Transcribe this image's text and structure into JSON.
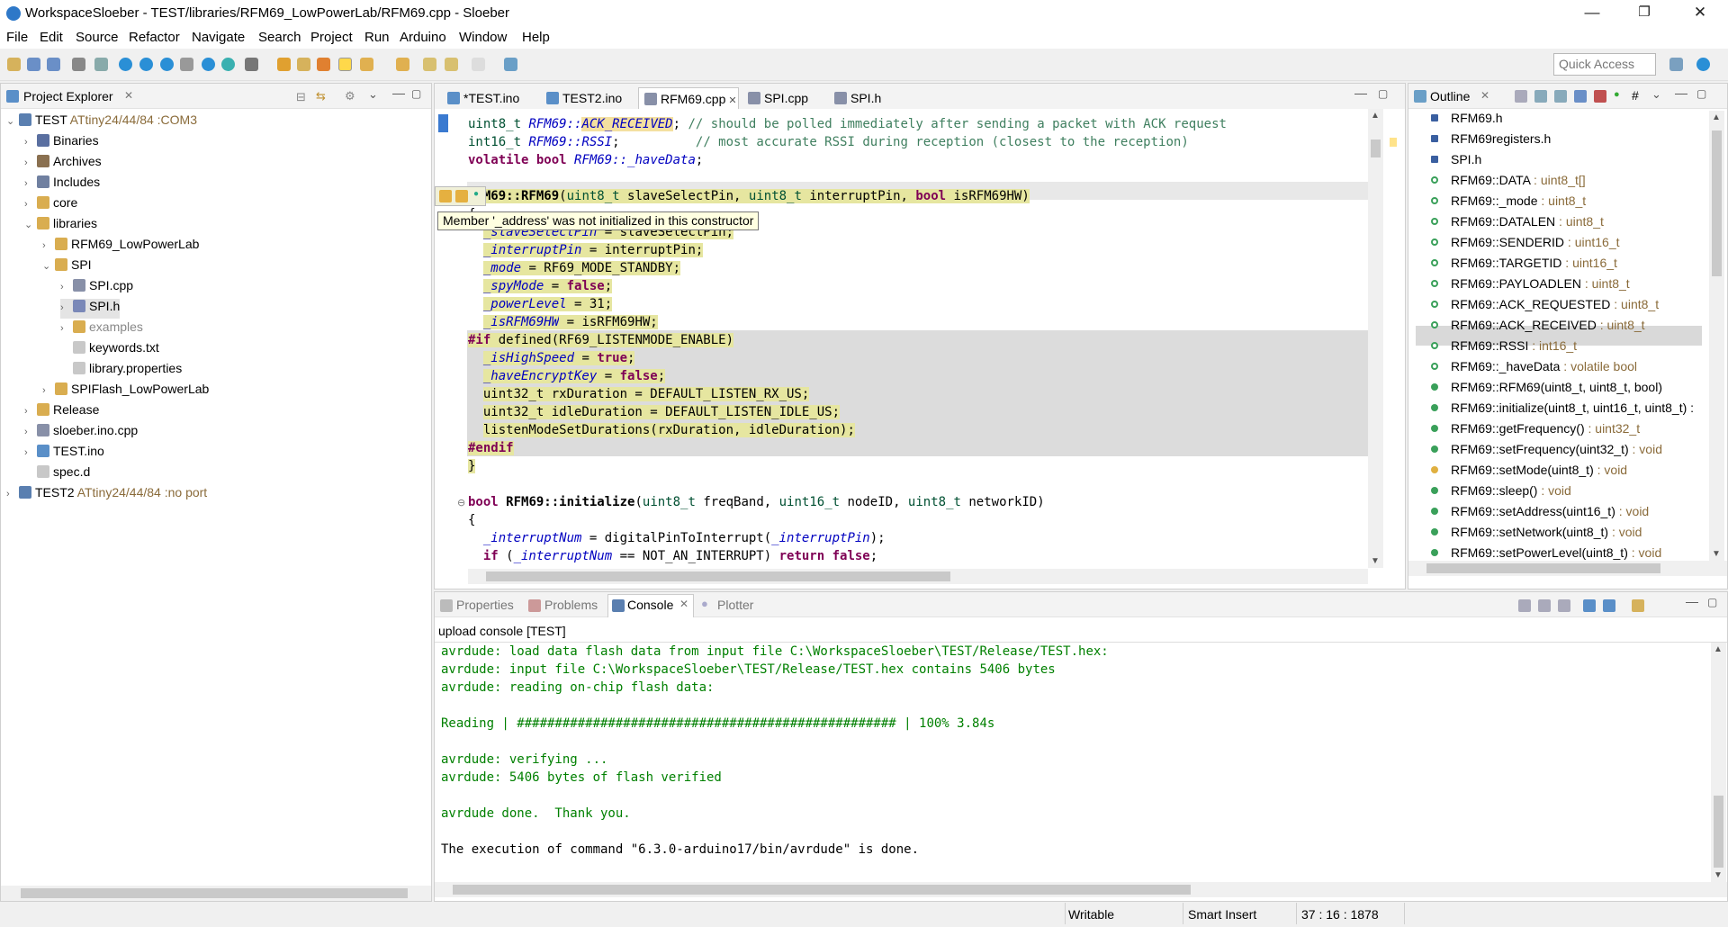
{
  "window": {
    "title": "WorkspaceSloeber - TEST/libraries/RFM69_LowPowerLab/RFM69.cpp - Sloeber",
    "minimize": "—",
    "restore": "❐",
    "close": "✕"
  },
  "menu": [
    "File",
    "Edit",
    "Source",
    "Refactor",
    "Navigate",
    "Search",
    "Project",
    "Run",
    "Arduino",
    "Window",
    "Help"
  ],
  "quick_access_placeholder": "Quick Access",
  "project_explorer": {
    "title": "Project Explorer",
    "close": "✕",
    "tree": [
      {
        "label": "TEST",
        "suffix": "ATtiny24/44/84 :COM3",
        "level": 0,
        "arrow": "⌄",
        "icon": "project-icon"
      },
      {
        "label": "Binaries",
        "suffix": "",
        "level": 1,
        "arrow": "›",
        "icon": "binaries-icon"
      },
      {
        "label": "Archives",
        "suffix": "",
        "level": 1,
        "arrow": "›",
        "icon": "archives-icon"
      },
      {
        "label": "Includes",
        "suffix": "",
        "level": 1,
        "arrow": "›",
        "icon": "includes-icon"
      },
      {
        "label": "core",
        "suffix": "",
        "level": 1,
        "arrow": "›",
        "icon": "folder-icon"
      },
      {
        "label": "libraries",
        "suffix": "",
        "level": 1,
        "arrow": "⌄",
        "icon": "folder-icon"
      },
      {
        "label": "RFM69_LowPowerLab",
        "suffix": "",
        "level": 2,
        "arrow": "›",
        "icon": "folder-icon"
      },
      {
        "label": "SPI",
        "suffix": "",
        "level": 2,
        "arrow": "⌄",
        "icon": "folder-icon"
      },
      {
        "label": "SPI.cpp",
        "suffix": "",
        "level": 3,
        "arrow": "›",
        "icon": "cpp-file-icon"
      },
      {
        "label": "SPI.h",
        "suffix": "",
        "level": 3,
        "arrow": "›",
        "icon": "header-file-icon"
      },
      {
        "label": "examples",
        "suffix": "",
        "level": 3,
        "arrow": "›",
        "icon": "folder-icon"
      },
      {
        "label": "keywords.txt",
        "suffix": "",
        "level": 3,
        "arrow": "",
        "icon": "file-icon"
      },
      {
        "label": "library.properties",
        "suffix": "",
        "level": 3,
        "arrow": "",
        "icon": "file-icon"
      },
      {
        "label": "SPIFlash_LowPowerLab",
        "suffix": "",
        "level": 2,
        "arrow": "›",
        "icon": "folder-icon"
      },
      {
        "label": "Release",
        "suffix": "",
        "level": 1,
        "arrow": "›",
        "icon": "folder-icon"
      },
      {
        "label": "sloeber.ino.cpp",
        "suffix": "",
        "level": 1,
        "arrow": "›",
        "icon": "cpp-file-icon"
      },
      {
        "label": "TEST.ino",
        "suffix": "",
        "level": 1,
        "arrow": "›",
        "icon": "ino-file-icon"
      },
      {
        "label": "spec.d",
        "suffix": "",
        "level": 1,
        "arrow": "",
        "icon": "file-icon"
      },
      {
        "label": "TEST2",
        "suffix": "ATtiny24/44/84 :no port",
        "level": 0,
        "arrow": "›",
        "icon": "project-icon"
      }
    ]
  },
  "editor": {
    "tabs": [
      {
        "label": "*TEST.ino",
        "active": false
      },
      {
        "label": "TEST2.ino",
        "active": false
      },
      {
        "label": "RFM69.cpp",
        "active": true
      },
      {
        "label": "SPI.cpp",
        "active": false
      },
      {
        "label": "SPI.h",
        "active": false
      }
    ],
    "tooltip": "Member '_address' was not initialized in this constructor"
  },
  "outline": {
    "title": "Outline",
    "items": [
      {
        "name": "RFM69.h",
        "type": "",
        "kind": "include"
      },
      {
        "name": "RFM69registers.h",
        "type": "",
        "kind": "include"
      },
      {
        "name": "SPI.h",
        "type": "",
        "kind": "include"
      },
      {
        "name": "RFM69::DATA",
        "type": " : uint8_t[]",
        "kind": "field"
      },
      {
        "name": "RFM69::_mode",
        "type": " : uint8_t",
        "kind": "field"
      },
      {
        "name": "RFM69::DATALEN",
        "type": " : uint8_t",
        "kind": "field"
      },
      {
        "name": "RFM69::SENDERID",
        "type": " : uint16_t",
        "kind": "field"
      },
      {
        "name": "RFM69::TARGETID",
        "type": " : uint16_t",
        "kind": "field"
      },
      {
        "name": "RFM69::PAYLOADLEN",
        "type": " : uint8_t",
        "kind": "field"
      },
      {
        "name": "RFM69::ACK_REQUESTED",
        "type": " : uint8_t",
        "kind": "field"
      },
      {
        "name": "RFM69::ACK_RECEIVED",
        "type": " : uint8_t",
        "kind": "field"
      },
      {
        "name": "RFM69::RSSI",
        "type": " : int16_t",
        "kind": "field"
      },
      {
        "name": "RFM69::_haveData",
        "type": " : volatile bool",
        "kind": "field"
      },
      {
        "name": "RFM69::RFM69(uint8_t, uint8_t, bool)",
        "type": "",
        "kind": "constructor"
      },
      {
        "name": "RFM69::initialize(uint8_t, uint16_t, uint8_t) :",
        "type": "",
        "kind": "method"
      },
      {
        "name": "RFM69::getFrequency()",
        "type": " : uint32_t",
        "kind": "method"
      },
      {
        "name": "RFM69::setFrequency(uint32_t)",
        "type": " : void",
        "kind": "method"
      },
      {
        "name": "RFM69::setMode(uint8_t)",
        "type": " : void",
        "kind": "protected"
      },
      {
        "name": "RFM69::sleep()",
        "type": " : void",
        "kind": "method"
      },
      {
        "name": "RFM69::setAddress(uint16_t)",
        "type": " : void",
        "kind": "method"
      },
      {
        "name": "RFM69::setNetwork(uint8_t)",
        "type": " : void",
        "kind": "method"
      },
      {
        "name": "RFM69::setPowerLevel(uint8_t)",
        "type": " : void",
        "kind": "method"
      }
    ]
  },
  "bottom": {
    "tabs": [
      "Properties",
      "Problems",
      "Console",
      "Plotter"
    ],
    "console_title": "upload console [TEST]",
    "lines": [
      "avrdude: load data flash data from input file C:\\WorkspaceSloeber\\TEST/Release/TEST.hex:",
      "avrdude: input file C:\\WorkspaceSloeber\\TEST/Release/TEST.hex contains 5406 bytes",
      "avrdude: reading on-chip flash data:",
      "",
      "Reading | ################################################## | 100% 3.84s",
      "",
      "avrdude: verifying ...",
      "avrdude: 5406 bytes of flash verified",
      "",
      "avrdude done.  Thank you.",
      "",
      "The execution of command \"6.3.0-arduino17/bin/avrdude\" is done."
    ]
  },
  "statusbar": {
    "writable": "Writable",
    "insert_mode": "Smart Insert",
    "position": "37 : 16 : 1878"
  },
  "colors": {
    "keyword": "#7f0055",
    "type": "#005032",
    "field": "#0000c0",
    "comment": "#3f7f5f",
    "console_text": "#008000",
    "selection": "#cfe3f5"
  }
}
